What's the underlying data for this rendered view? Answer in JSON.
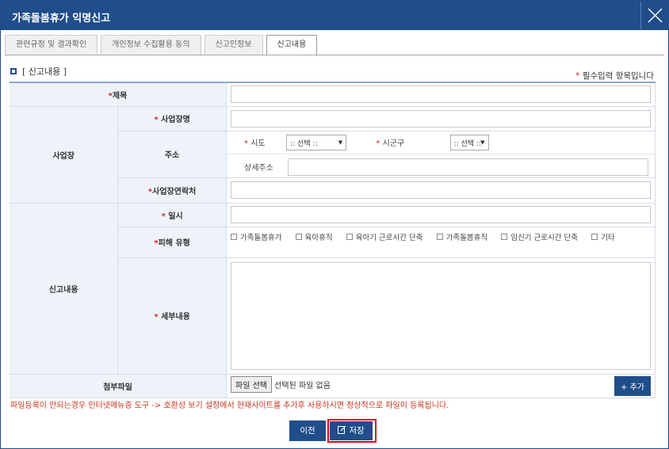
{
  "window": {
    "title": "가족돌봄휴가 익명신고",
    "close_icon": "close-icon"
  },
  "tabs": [
    {
      "label": "관련규정 및 결과확인",
      "active": false
    },
    {
      "label": "개인정보 수집활용 동의",
      "active": false
    },
    {
      "label": "신고인정보",
      "active": false
    },
    {
      "label": "신고내용",
      "active": true
    }
  ],
  "section": {
    "title": "[ 신고내용 ]"
  },
  "required_note": {
    "star": "*",
    "text": " 필수입력 항목입니다"
  },
  "form": {
    "star": "*",
    "title_label": "제목",
    "workplace": {
      "group_label": "사업장",
      "name_label": "사업장명",
      "address_label": "주소",
      "sido_label": "시도",
      "sido_value": ":: 선택 ::",
      "sigungu_label": "시군구",
      "sigungu_value": ":: 선택 ::",
      "detail_label": "상세주소",
      "contact_label": "사업장연락처"
    },
    "report": {
      "group_label": "신고내용",
      "date_label": "일시",
      "damage_label": "피해 유형",
      "damage_types": [
        "가족돌봄휴가",
        "육아휴직",
        "육아기 근로시간 단축",
        "가족돌봄휴직",
        "임신기 근로시간 단축",
        "기타"
      ],
      "detail_label": "세부내용"
    },
    "attach": {
      "label": "첨부파일",
      "file_button": "파일 선택",
      "file_status": "선택된 파일 없음",
      "add_button": "+ 추가"
    }
  },
  "warning": "파일등록이 안되는경우 인터넷메뉴중 도구 -> 호환성 보기 설정에서 현재사이트를 추가후 사용하시면 정상적으로 파일이 등록됩니다.",
  "buttons": {
    "prev": "이전",
    "save": "저장"
  },
  "colors": {
    "primary": "#1f4e8a",
    "required": "#d9261c",
    "highlight": "#e0001b",
    "label_bg": "#eef3fa"
  }
}
